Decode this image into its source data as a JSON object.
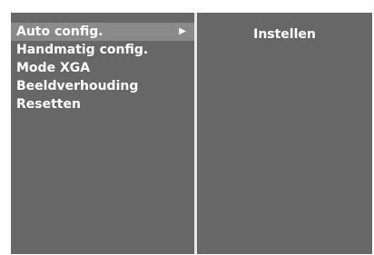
{
  "menu": {
    "items": [
      {
        "label": "Auto config.",
        "selected": true
      },
      {
        "label": "Handmatig config.",
        "selected": false
      },
      {
        "label": "Mode XGA",
        "selected": false
      },
      {
        "label": "Beeldverhouding",
        "selected": false
      },
      {
        "label": "Resetten",
        "selected": false
      }
    ],
    "arrow_icon": "▶"
  },
  "submenu": {
    "option_label": "Instellen"
  },
  "colors": {
    "panel_background": "#676767",
    "selected_row": "#8a8a8a",
    "divider": "#e6e6e6",
    "text": "#ffffff"
  }
}
